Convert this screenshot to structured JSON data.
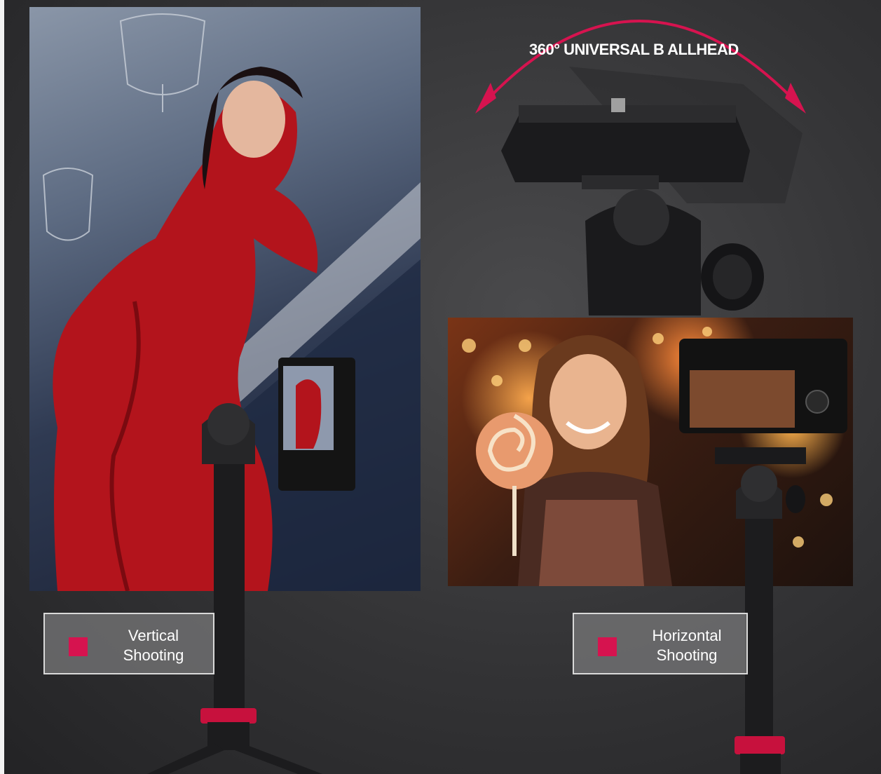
{
  "headline": "360° UNIVERSAL B ALLHEAD",
  "labels": {
    "vertical": {
      "line1": "Vertical",
      "line2": "Shooting"
    },
    "horizontal": {
      "line1": "Horizontal",
      "line2": "Shooting"
    }
  },
  "colors": {
    "accent": "#d6134f",
    "background": "#3a3a3c",
    "label_box": "#7a7a7c",
    "label_border": "#d9d9d9"
  },
  "icons": [
    "rotation-arrow-icon",
    "ballhead-icon",
    "camera-icon",
    "tripod-icon"
  ]
}
